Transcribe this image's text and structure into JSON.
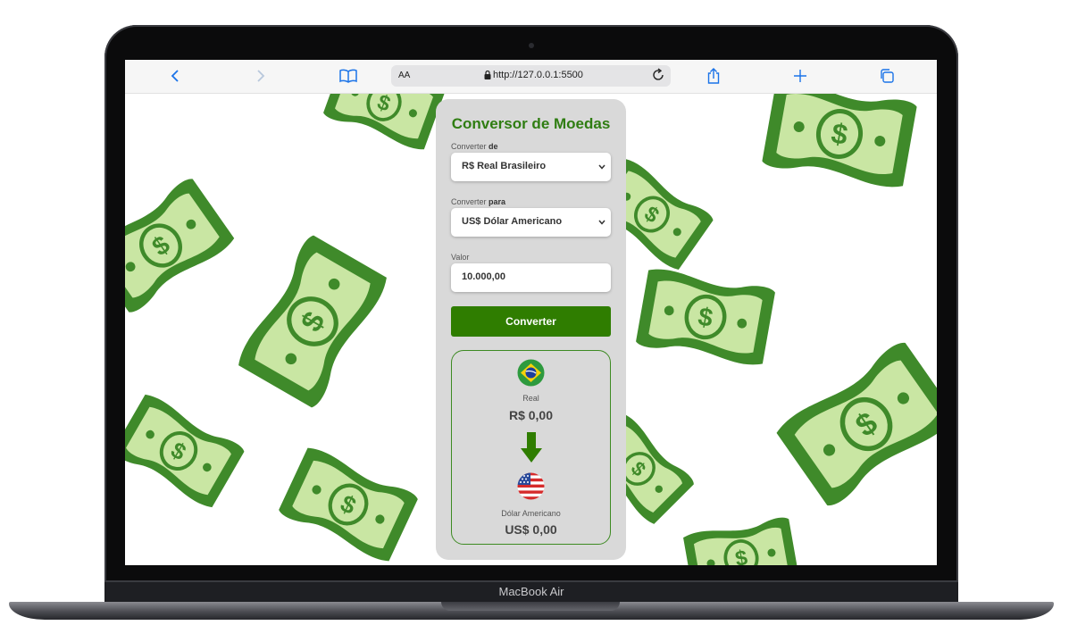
{
  "device": {
    "label": "MacBook Air"
  },
  "browser": {
    "reader_label": "AA",
    "url": "http://127.0.0.1:5500",
    "icons": [
      "back-icon",
      "forward-icon",
      "bookmarks-icon",
      "lock-icon",
      "reload-icon",
      "share-icon",
      "new-tab-icon",
      "tabs-icon"
    ]
  },
  "app": {
    "title": "Conversor de Moedas",
    "from": {
      "label_prefix": "Converter ",
      "label_bold": "de",
      "selected": "R$ Real Brasileiro"
    },
    "to": {
      "label_prefix": "Converter ",
      "label_bold": "para",
      "selected": "US$ Dólar Americano"
    },
    "amount": {
      "label": "Valor",
      "value": "10.000,00"
    },
    "convert_button": "Converter",
    "result": {
      "source_name": "Real",
      "source_value": "R$ 0,00",
      "target_name": "Dólar Americano",
      "target_value": "US$ 0,00"
    }
  },
  "colors": {
    "brand_green": "#2f7d12",
    "button_green": "#2f7d00",
    "card_bg": "#d9d9d9",
    "money_dark": "#3f8a2a",
    "money_light": "#c9e6a3"
  }
}
